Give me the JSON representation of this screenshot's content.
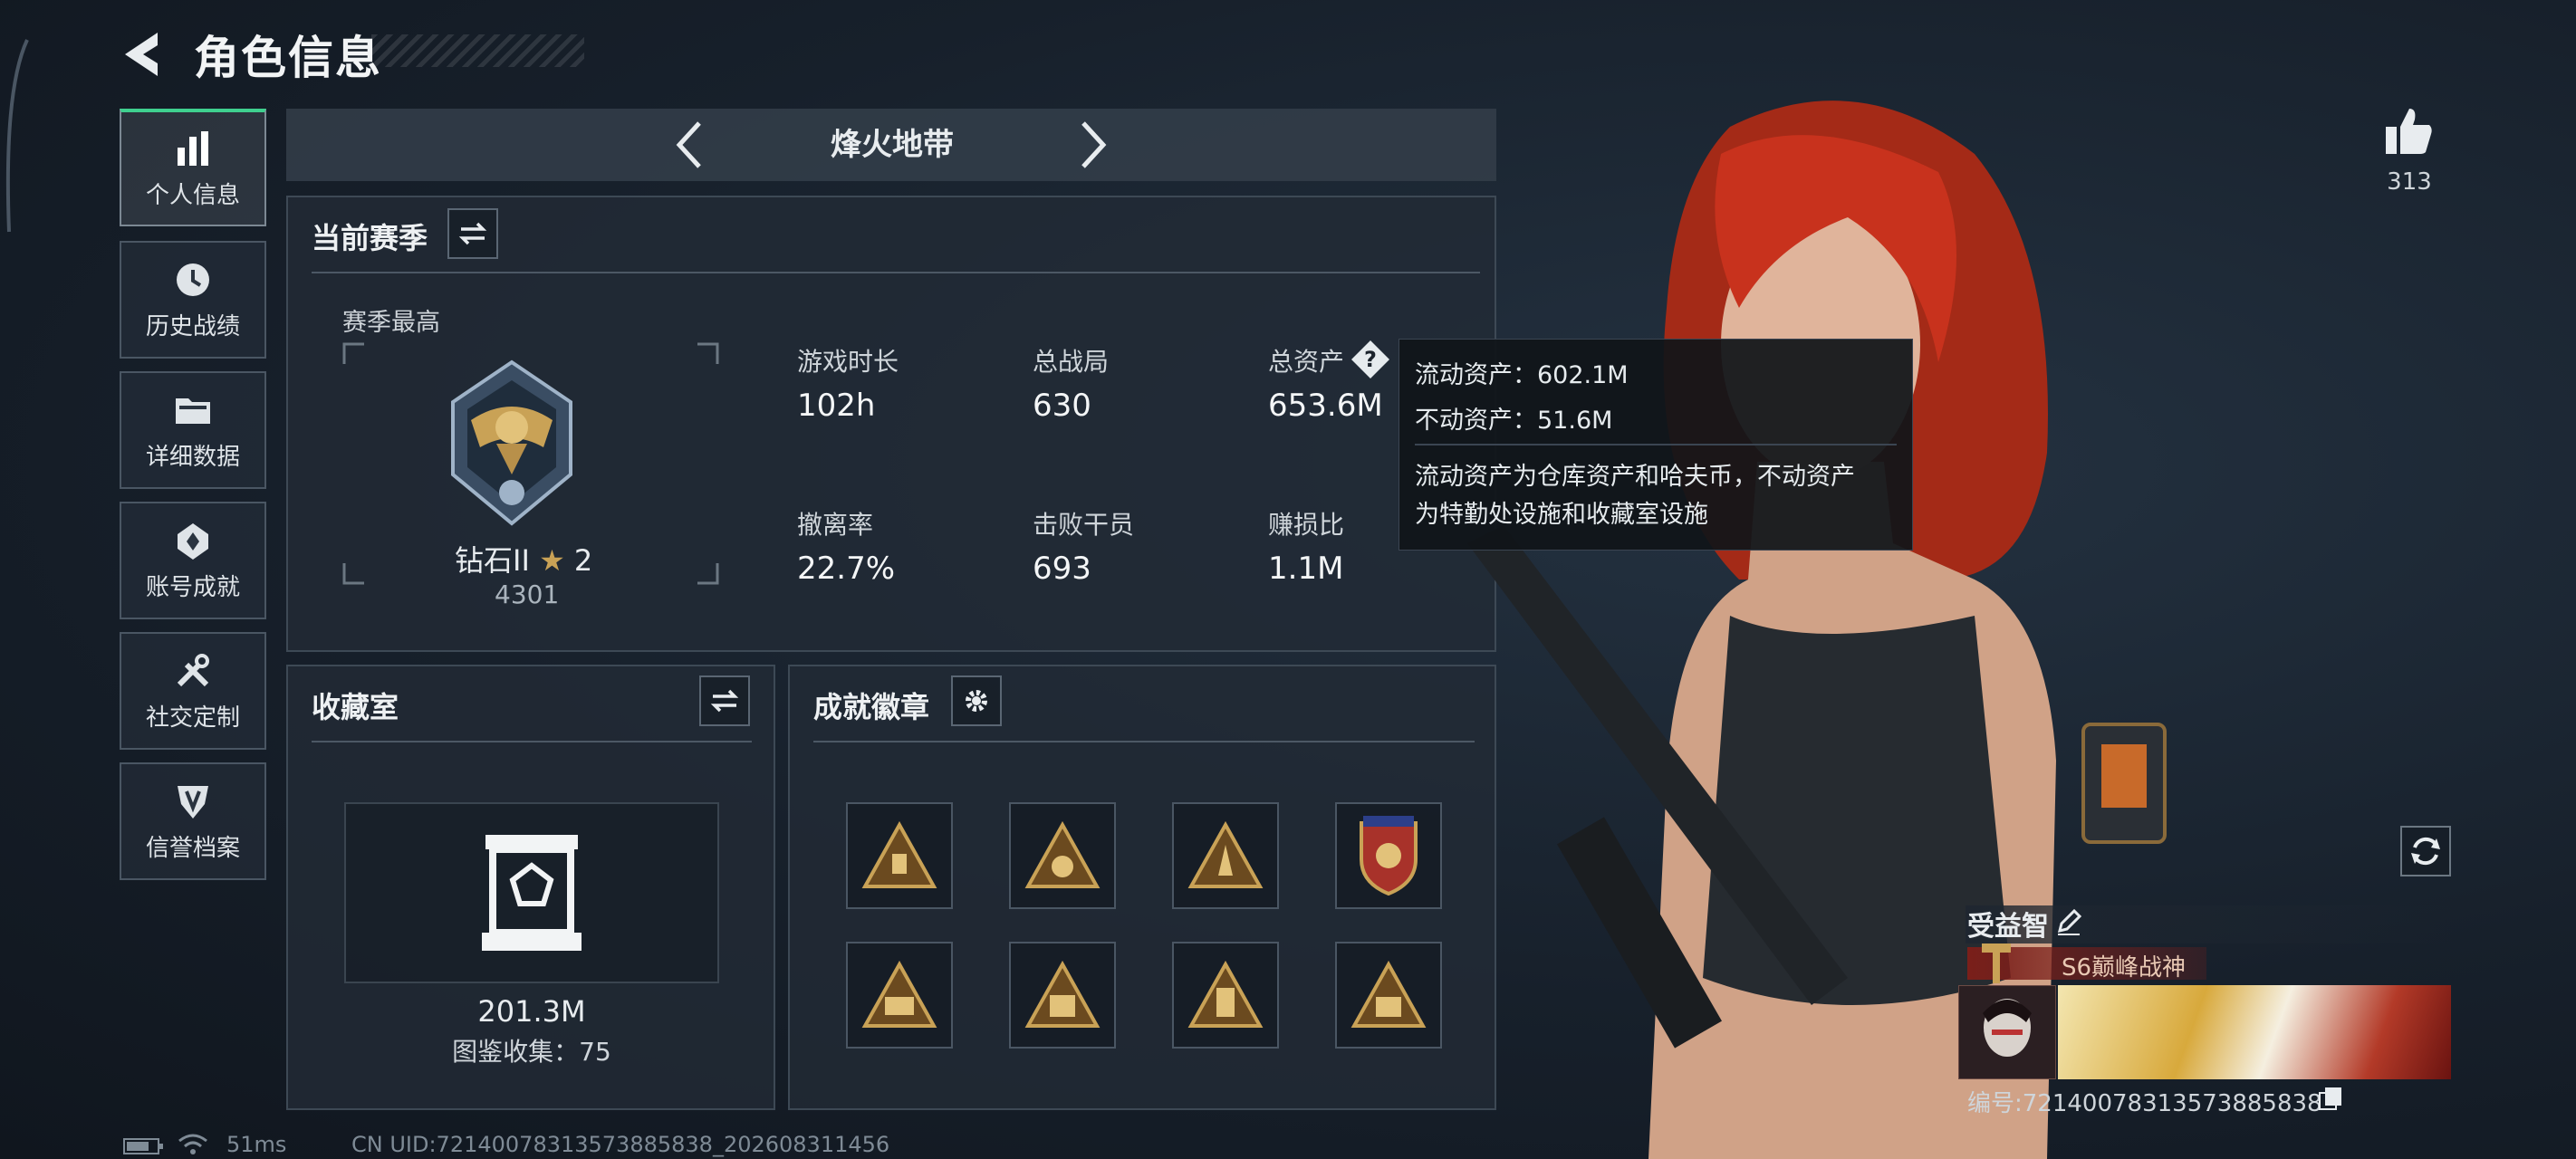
{
  "header": {
    "title": "角色信息"
  },
  "sidebar": {
    "items": [
      {
        "label": "个人信息",
        "icon": "bar-chart-icon",
        "active": true
      },
      {
        "label": "历史战绩",
        "icon": "clock-icon"
      },
      {
        "label": "详细数据",
        "icon": "folder-icon"
      },
      {
        "label": "账号成就",
        "icon": "achievement-icon"
      },
      {
        "label": "社交定制",
        "icon": "tools-icon"
      },
      {
        "label": "信誉档案",
        "icon": "shield-icon"
      }
    ]
  },
  "mode": {
    "name": "烽火地带"
  },
  "season": {
    "title": "当前赛季",
    "best_label": "赛季最高",
    "rank_name": "钻石II",
    "rank_stars": "2",
    "rank_score": "4301",
    "stats": [
      {
        "label": "游戏时长",
        "value": "102h"
      },
      {
        "label": "总战局",
        "value": "630"
      },
      {
        "label": "总资产",
        "value": "653.6M"
      },
      {
        "label": "撤离率",
        "value": "22.7%"
      },
      {
        "label": "击败干员",
        "value": "693"
      },
      {
        "label": "赚损比",
        "value": "1.1M"
      }
    ]
  },
  "tooltip": {
    "liquid": "流动资产：602.1M",
    "fixed": "不动资产：51.6M",
    "desc_line1": "流动资产为仓库资产和哈夫币，不动资产",
    "desc_line2": "为特勤处设施和收藏室设施"
  },
  "collection": {
    "title": "收藏室",
    "value": "201.3M",
    "catalog": "图鉴收集：75"
  },
  "achievements": {
    "title": "成就徽章",
    "badges": [
      "badge-1",
      "badge-2",
      "badge-3",
      "badge-4",
      "badge-5",
      "badge-6",
      "badge-7",
      "badge-8"
    ]
  },
  "profile": {
    "likes": "313",
    "name": "受益智",
    "title_badge": "S6巅峰战神",
    "id_text": "编号:7214007831357388583­8"
  },
  "footer": {
    "ping": "51ms",
    "uid": "CN UID:7214007831357388583­8_202608311456"
  },
  "colors": {
    "accent_green": "#3fd08f",
    "gold": "#c9a256",
    "hair": "#c8321d"
  }
}
